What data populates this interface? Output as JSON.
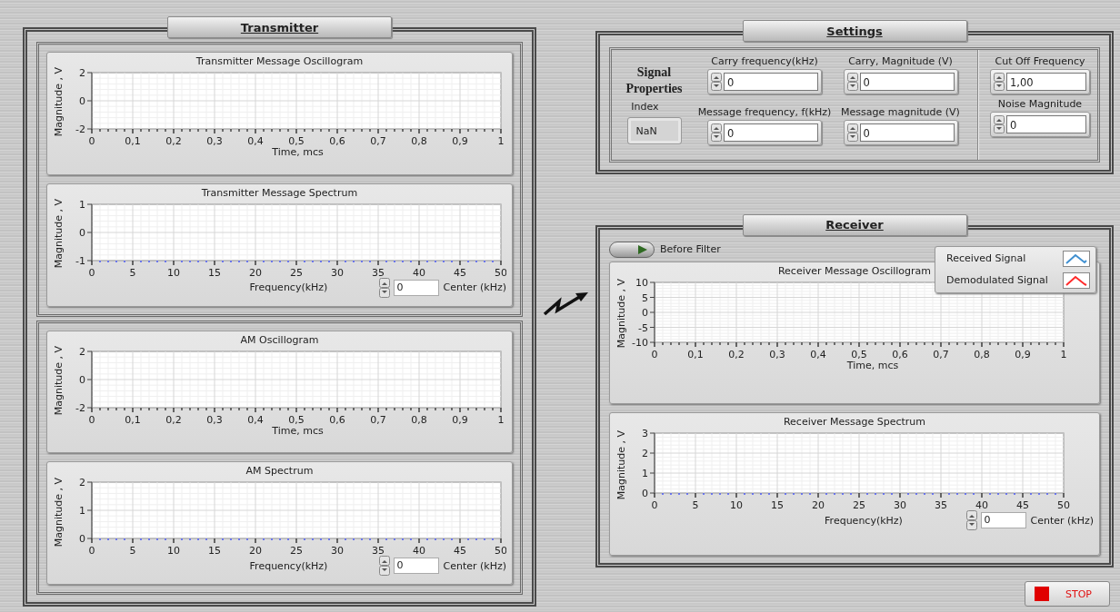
{
  "transmitter": {
    "title": "Transmitter",
    "groups": [
      {
        "charts": [
          {
            "kind": "oscillogram",
            "chart_data": {
              "type": "line",
              "title": "Transmitter Message Oscillogram",
              "grid": true,
              "xlabel": "Time, mcs",
              "ylabel": "Magnitude , V",
              "xlim": [
                0,
                1
              ],
              "ylim": [
                -2,
                2
              ],
              "xticks": [
                0,
                {
                  "value": 0.1,
                  "label": "0,1"
                },
                {
                  "value": 0.2,
                  "label": "0,2"
                },
                {
                  "value": 0.3,
                  "label": "0,3"
                },
                {
                  "value": 0.4,
                  "label": "0,4"
                },
                {
                  "value": 0.5,
                  "label": "0,5"
                },
                {
                  "value": 0.6,
                  "label": "0,6"
                },
                {
                  "value": 0.7,
                  "label": "0,7"
                },
                {
                  "value": 0.8,
                  "label": "0,8"
                },
                {
                  "value": 0.9,
                  "label": "0,9"
                },
                1
              ],
              "yticks": [
                -2,
                0,
                2
              ]
            }
          },
          {
            "kind": "spectrum",
            "center": {
              "value": "0",
              "label": "Center (kHz)"
            },
            "chart_data": {
              "type": "line",
              "title": "Transmitter Message Spectrum",
              "grid": true,
              "xlabel": "Frequency(kHz)",
              "ylabel": "Magnitude , V",
              "xlim": [
                0,
                50
              ],
              "ylim": [
                -1,
                1
              ],
              "xticks": [
                0,
                5,
                10,
                15,
                20,
                25,
                30,
                35,
                40,
                45,
                50
              ],
              "yticks": [
                -1,
                0,
                1
              ]
            }
          }
        ]
      },
      {
        "charts": [
          {
            "kind": "oscillogram",
            "chart_data": {
              "type": "line",
              "title": "AM Oscillogram",
              "grid": true,
              "xlabel": "Time, mcs",
              "ylabel": "Magnitude , V",
              "xlim": [
                0,
                1
              ],
              "ylim": [
                -2,
                2
              ],
              "xticks": [
                0,
                {
                  "value": 0.1,
                  "label": "0,1"
                },
                {
                  "value": 0.2,
                  "label": "0,2"
                },
                {
                  "value": 0.3,
                  "label": "0,3"
                },
                {
                  "value": 0.4,
                  "label": "0,4"
                },
                {
                  "value": 0.5,
                  "label": "0,5"
                },
                {
                  "value": 0.6,
                  "label": "0,6"
                },
                {
                  "value": 0.7,
                  "label": "0,7"
                },
                {
                  "value": 0.8,
                  "label": "0,8"
                },
                {
                  "value": 0.9,
                  "label": "0,9"
                },
                1
              ],
              "yticks": [
                -2,
                0,
                2
              ]
            }
          },
          {
            "kind": "spectrum",
            "center": {
              "value": "0",
              "label": "Center (kHz)"
            },
            "chart_data": {
              "type": "line",
              "title": "AM Spectrum",
              "grid": true,
              "xlabel": "Frequency(kHz)",
              "ylabel": "Magnitude , V",
              "xlim": [
                0,
                50
              ],
              "ylim": [
                0,
                2
              ],
              "xticks": [
                0,
                5,
                10,
                15,
                20,
                25,
                30,
                35,
                40,
                45,
                50
              ],
              "yticks": [
                0,
                1,
                2
              ]
            }
          }
        ]
      }
    ]
  },
  "settings": {
    "title": "Settings",
    "signal_properties": {
      "heading": "Signal Properties",
      "index_label": "Index",
      "index_value": "NaN"
    },
    "fields": [
      {
        "label": "Carry frequency(kHz)",
        "value": "0"
      },
      {
        "label": "Carry, Magnitude (V)",
        "value": "0"
      },
      {
        "label": "Message frequency, f(kHz)",
        "value": "0"
      },
      {
        "label": "Message magnitude (V)",
        "value": "0"
      }
    ],
    "filter_fields": [
      {
        "label": "Cut Off Frequency",
        "value": "1,00"
      },
      {
        "label": "Noise Magnitude",
        "value": "0"
      }
    ]
  },
  "receiver": {
    "title": "Receiver",
    "toggle": {
      "label": "Before Filter",
      "on": false
    },
    "legend": [
      {
        "name": "Received Signal",
        "color": "#3f8fd0"
      },
      {
        "name": "Demodulated Signal",
        "color": "#ff2a2a"
      }
    ],
    "charts": [
      {
        "kind": "oscillogram",
        "chart_data": {
          "type": "line",
          "title": "Receiver Message Oscillogram",
          "grid": true,
          "xlabel": "Time, mcs",
          "ylabel": "Magnitude , V",
          "xlim": [
            0,
            1
          ],
          "ylim": [
            -10,
            10
          ],
          "xticks": [
            0,
            {
              "value": 0.1,
              "label": "0,1"
            },
            {
              "value": 0.2,
              "label": "0,2"
            },
            {
              "value": 0.3,
              "label": "0,3"
            },
            {
              "value": 0.4,
              "label": "0,4"
            },
            {
              "value": 0.5,
              "label": "0,5"
            },
            {
              "value": 0.6,
              "label": "0,6"
            },
            {
              "value": 0.7,
              "label": "0,7"
            },
            {
              "value": 0.8,
              "label": "0,8"
            },
            {
              "value": 0.9,
              "label": "0,9"
            },
            1
          ],
          "yticks": [
            -10,
            -5,
            0,
            5,
            10
          ]
        }
      },
      {
        "kind": "spectrum",
        "center": {
          "value": "0",
          "label": "Center (kHz)"
        },
        "chart_data": {
          "type": "line",
          "title": "Receiver Message Spectrum",
          "grid": true,
          "xlabel": "Frequency(kHz)",
          "ylabel": "Magnitude , V",
          "xlim": [
            0,
            50
          ],
          "ylim": [
            0,
            3
          ],
          "xticks": [
            0,
            5,
            10,
            15,
            20,
            25,
            30,
            35,
            40,
            45,
            50
          ],
          "yticks": [
            0,
            1,
            2,
            3
          ]
        }
      }
    ]
  },
  "stop_button": {
    "label": "STOP"
  }
}
